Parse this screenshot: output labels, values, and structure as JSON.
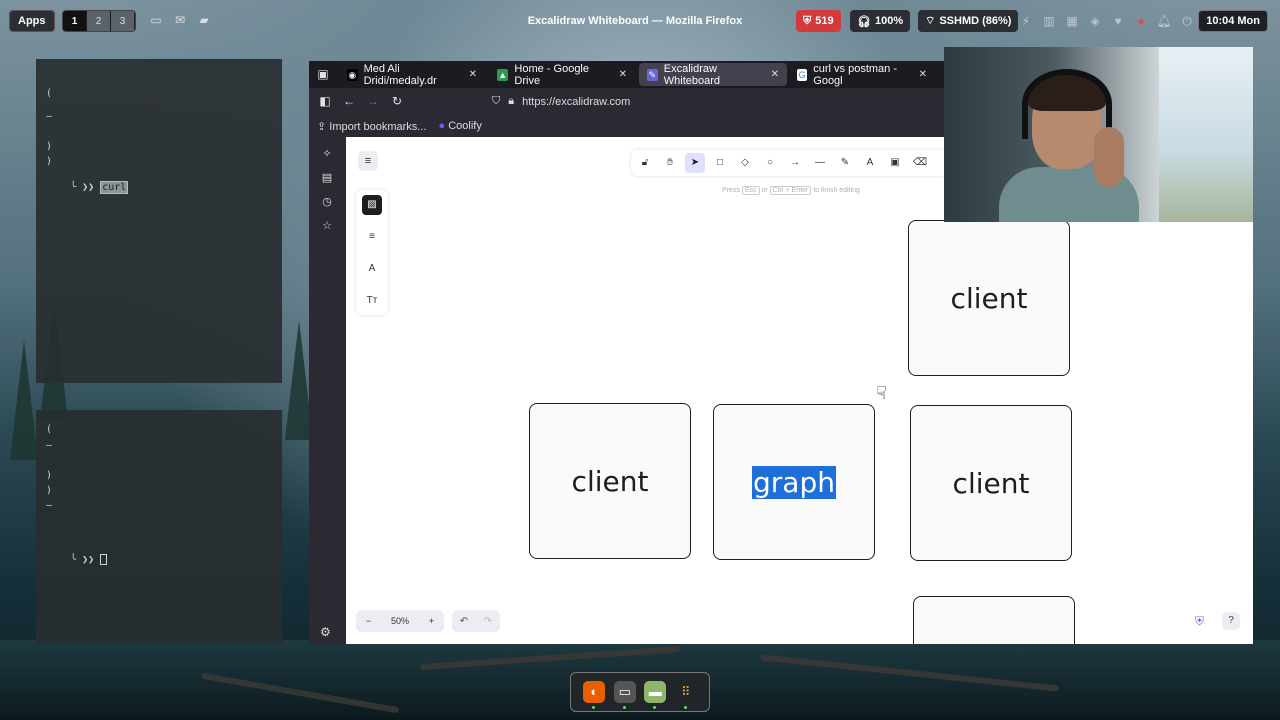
{
  "topbar": {
    "apps_label": "Apps",
    "workspaces": [
      "1",
      "2",
      "3"
    ],
    "window_title": "Excalidraw Whiteboard — Mozilla Firefox",
    "notification_count": "519",
    "volume": "100%",
    "wifi": "SSHMD (86%)",
    "clock": "10:04 Mon"
  },
  "terminal1": {
    "lines": [
      "(",
      "—",
      ")",
      ")"
    ],
    "prompt": "╰ ❯❯",
    "command": "curl"
  },
  "terminal2": {
    "lines": [
      "(",
      "—",
      ")",
      ")",
      "—"
    ],
    "prompt": "╰ ❯❯"
  },
  "browser": {
    "tabs": [
      {
        "label": "Med Ali Dridi/medaly.dr",
        "favicon": "github-icon"
      },
      {
        "label": "Home - Google Drive",
        "favicon": "google-drive-icon"
      },
      {
        "label": "Excalidraw Whiteboard",
        "favicon": "excalidraw-icon"
      },
      {
        "label": "curl vs postman - Googl",
        "favicon": "google-icon"
      }
    ],
    "url": "https://excalidraw.com",
    "bookmarks": [
      "Import bookmarks...",
      "Coolify"
    ]
  },
  "excalidraw": {
    "hint": {
      "press": "Press",
      "esc": "Esc",
      "or": "or",
      "ctrl_enter": "Ctrl + Enter",
      "tail": "to finish editing"
    },
    "boxes": {
      "top_right": "client",
      "left": "client",
      "center": "graph",
      "right": "client"
    },
    "zoom": "50%",
    "zoom_minus": "−",
    "zoom_plus": "+"
  }
}
